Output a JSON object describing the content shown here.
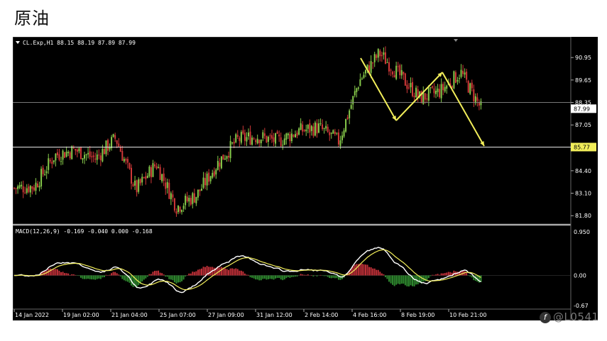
{
  "page_title": "原油",
  "watermark": {
    "icon": "facebook-icon",
    "text": "@L0541"
  },
  "price_pane": {
    "symbol_line": "CL.Exp,H1  88.15 88.19 87.89 87.99",
    "y_ticks": [
      "90.95",
      "89.65",
      "88.35",
      "87.05",
      "84.40",
      "83.10",
      "81.80"
    ],
    "current_price_label": "87.99",
    "level_label": "85.77"
  },
  "macd_pane": {
    "label": "MACD(12,26,9) -0.169 -0.040 0.000 -0.168",
    "y_ticks": [
      "0.950",
      "0.00",
      "-0.67"
    ]
  },
  "x_ticks": [
    "14 Jan 2022",
    "19 Jan 02:00",
    "21 Jan 04:00",
    "25 Jan 07:00",
    "27 Jan 09:00",
    "31 Jan 12:00",
    "2 Feb 14:00",
    "4 Feb 16:00",
    "8 Feb 19:00",
    "10 Feb 21:00"
  ],
  "colors": {
    "background": "#000000",
    "bull": "#86c94a",
    "bear": "#d13838",
    "annotation": "#f2ee5a",
    "macd_line": "#ffffff",
    "signal_line": "#f2ee5a",
    "hist_pos": "#c03038",
    "hist_neg": "#2f8a2f"
  },
  "chart_data": {
    "type": "candlestick",
    "series": [
      {
        "name": "CL.Exp,H1",
        "last": {
          "open": 88.15,
          "high": 88.19,
          "low": 87.89,
          "close": 87.99
        }
      },
      {
        "name": "MACD(12,26,9)",
        "values": [
          -0.169,
          -0.04,
          0.0,
          -0.168
        ]
      }
    ],
    "price_path": [
      {
        "x": "14 Jan 2022",
        "y": 83.4
      },
      {
        "x": "17 Jan",
        "y": 83.5
      },
      {
        "x": "18 Jan",
        "y": 85.3
      },
      {
        "x": "19 Jan 02:00",
        "y": 85.6
      },
      {
        "x": "20 Jan",
        "y": 85.1
      },
      {
        "x": "20 Jan b",
        "y": 86.3
      },
      {
        "x": "21 Jan 04:00",
        "y": 83.3
      },
      {
        "x": "21 Jan b",
        "y": 84.8
      },
      {
        "x": "24 Jan",
        "y": 82.3
      },
      {
        "x": "24 Jan b",
        "y": 83.0
      },
      {
        "x": "25 Jan 07:00",
        "y": 84.8
      },
      {
        "x": "26 Jan",
        "y": 86.2
      },
      {
        "x": "27 Jan 09:00",
        "y": 86.4
      },
      {
        "x": "28 Jan",
        "y": 86.1
      },
      {
        "x": "31 Jan 12:00",
        "y": 86.7
      },
      {
        "x": "1 Feb",
        "y": 86.9
      },
      {
        "x": "2 Feb 14:00",
        "y": 86.1
      },
      {
        "x": "3 Feb",
        "y": 89.6
      },
      {
        "x": "4 Feb 16:00",
        "y": 91.2
      },
      {
        "x": "7 Feb",
        "y": 89.9
      },
      {
        "x": "8 Feb 19:00",
        "y": 88.6
      },
      {
        "x": "9 Feb",
        "y": 89.0
      },
      {
        "x": "10 Feb",
        "y": 90.1
      },
      {
        "x": "10 Feb 21:00",
        "y": 88.0
      }
    ],
    "ylim": [
      81.4,
      91.9
    ],
    "horizontal_levels": [
      88.35,
      85.77
    ]
  }
}
